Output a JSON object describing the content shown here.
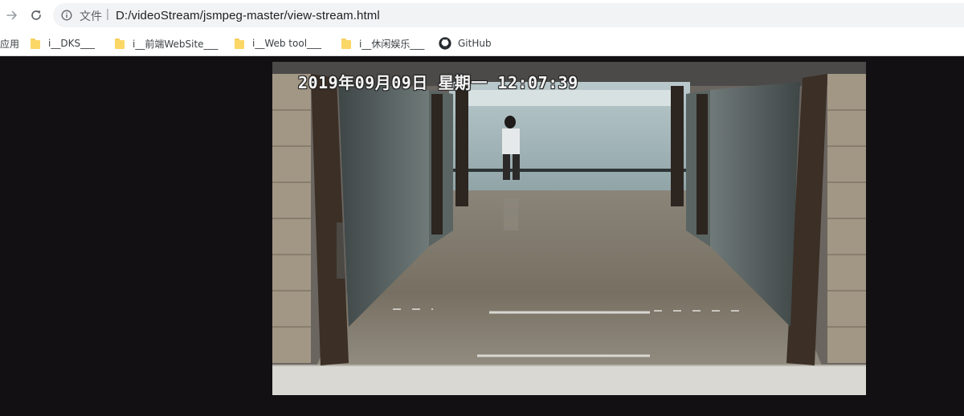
{
  "browser": {
    "address_scheme": "文件",
    "address_separator": "|",
    "url": "D:/videoStream/jsmpeg-master/view-stream.html"
  },
  "bookmarks": [
    {
      "label": "应用",
      "icon": "apps-icon"
    },
    {
      "label": "i__DKS___",
      "icon": "folder-icon"
    },
    {
      "label": "i__前端WebSite___",
      "icon": "folder-icon"
    },
    {
      "label": "i__Web tool___",
      "icon": "folder-icon"
    },
    {
      "label": "i__休闲娱乐___",
      "icon": "folder-icon"
    },
    {
      "label": "GitHub",
      "icon": "github-icon"
    }
  ],
  "video": {
    "timestamp_overlay": "2019年09月09日 星期一 12:07:39"
  },
  "colors": {
    "page_background": "#121012",
    "folder_yellow": "#fbd766",
    "omnibox_background": "#f1f3f4"
  }
}
